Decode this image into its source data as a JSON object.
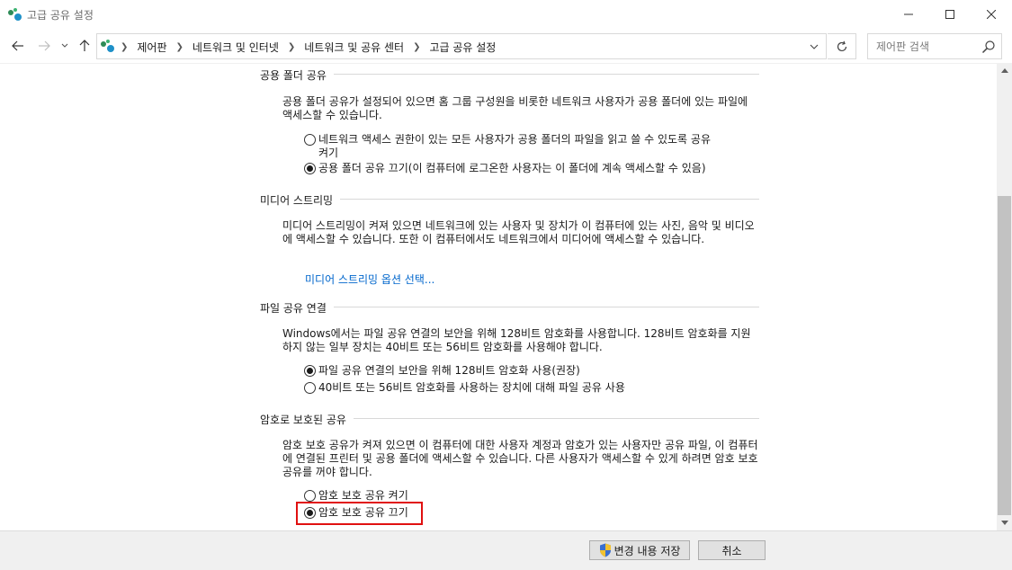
{
  "window": {
    "title": "고급 공유 설정"
  },
  "address": {
    "crumbs": [
      "제어판",
      "네트워크 및 인터넷",
      "네트워크 및 공유 센터",
      "고급 공유 설정"
    ]
  },
  "search": {
    "placeholder": "제어판 검색"
  },
  "sections": {
    "public_folder": {
      "heading": "공용 폴더 공유",
      "description": "공용 폴더 공유가 설정되어 있으면 홈 그룹 구성원을 비롯한 네트워크 사용자가 공용 폴더에 있는 파일에 액세스할 수 있습니다.",
      "option_on_line1": "네트워크 액세스 권한이 있는 모든 사용자가 공용 폴더의 파일을 읽고 쓸 수 있도록 공유",
      "option_on_line2": "켜기",
      "option_off": "공용 폴더 공유 끄기(이 컴퓨터에 로그온한 사용자는 이 폴더에 계속 액세스할 수 있음)",
      "selected": "off"
    },
    "media_streaming": {
      "heading": "미디어 스트리밍",
      "description": "미디어 스트리밍이 켜져 있으면 네트워크에 있는 사용자 및 장치가 이 컴퓨터에 있는 사진, 음악 및 비디오에 액세스할 수 있습니다. 또한 이 컴퓨터에서도 네트워크에서 미디어에 액세스할 수 있습니다.",
      "link": "미디어 스트리밍 옵션 선택..."
    },
    "file_sharing": {
      "heading": "파일 공유 연결",
      "description": "Windows에서는 파일 공유 연결의 보안을 위해 128비트 암호화를 사용합니다. 128비트 암호화를 지원하지 않는 일부 장치는 40비트 또는 56비트 암호화를 사용해야 합니다.",
      "option_128": "파일 공유 연결의 보안을 위해 128비트 암호화 사용(권장)",
      "option_40_56": "40비트 또는 56비트 암호화를 사용하는 장치에 대해 파일 공유 사용",
      "selected": "128"
    },
    "password_protected": {
      "heading": "암호로 보호된 공유",
      "description": "암호 보호 공유가 켜져 있으면 이 컴퓨터에 대한 사용자 계정과 암호가 있는 사용자만 공유 파일, 이 컴퓨터에 연결된 프린터 및 공용 폴더에 액세스할 수 있습니다. 다른 사용자가 액세스할 수 있게 하려면 암호 보호 공유를 꺼야 합니다.",
      "option_on": "암호 보호 공유 켜기",
      "option_off": "암호 보호 공유 끄기",
      "selected": "off"
    }
  },
  "footer": {
    "save_label": "변경 내용 저장",
    "cancel_label": "취소"
  },
  "scroll": {
    "thumb_start_fraction": 0.27,
    "thumb_size_fraction": 0.73
  },
  "colors": {
    "link": "#0066cc",
    "highlight": "#e01010"
  }
}
